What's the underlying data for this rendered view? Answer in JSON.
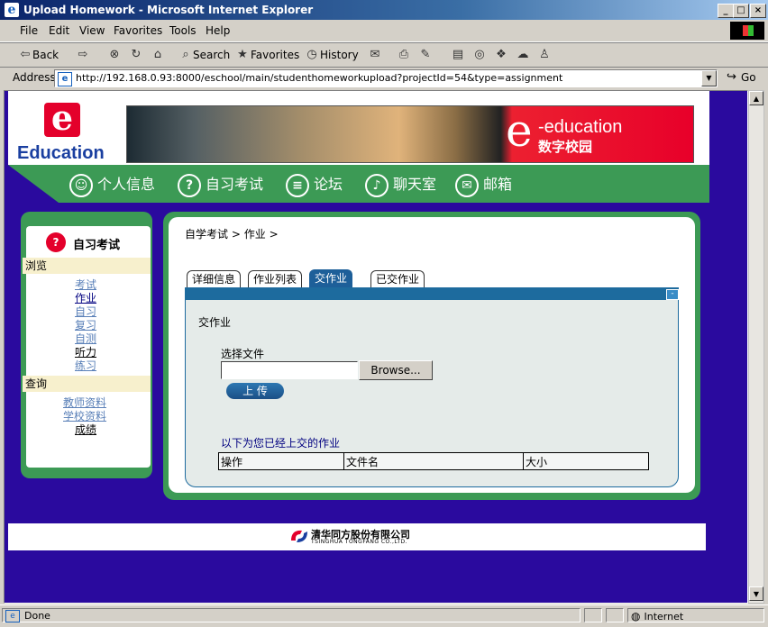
{
  "window": {
    "title": "Upload Homework - Microsoft Internet Explorer",
    "min": "_",
    "max": "□",
    "close": "×"
  },
  "menubar": [
    "File",
    "Edit",
    "View",
    "Favorites",
    "Tools",
    "Help"
  ],
  "toolbar": {
    "back": "Back",
    "search": "Search",
    "favorites": "Favorites",
    "history": "History"
  },
  "address": {
    "label": "Address",
    "url": "http://192.168.0.93:8000/eschool/main/studenthomeworkupload?projectId=54&type=assignment",
    "go": "Go"
  },
  "header": {
    "logo_letter": "e",
    "logo_text": "Education",
    "banner_e": "e",
    "banner_edu": "-education",
    "banner_cn": "数字校园"
  },
  "nav": [
    {
      "label": "个人信息",
      "icon": "person-icon"
    },
    {
      "label": "自习考试",
      "icon": "question-icon"
    },
    {
      "label": "论坛",
      "icon": "forum-icon"
    },
    {
      "label": "聊天室",
      "icon": "microphone-icon"
    },
    {
      "label": "邮箱",
      "icon": "mail-icon"
    }
  ],
  "sidebar": {
    "title": "自习考试",
    "browse_section": "浏览",
    "browse_items": [
      "考试",
      "作业",
      "自习",
      "复习",
      "自测",
      "听力",
      "练习"
    ],
    "query_section": "查询",
    "query_items": [
      "教师资料",
      "学校资料",
      "成绩"
    ]
  },
  "breadcrumb": {
    "root": "自学考试",
    "sep1": ">",
    "current": "作业",
    "sep2": ">"
  },
  "tabs": [
    "详细信息",
    "作业列表",
    "交作业",
    "已交作业"
  ],
  "active_tab": "交作业",
  "form": {
    "section_title": "交作业",
    "file_label": "选择文件",
    "file_value": "",
    "browse": "Browse...",
    "upload": "上 传",
    "list_label": "以下为您已经上交的作业",
    "columns": [
      "操作",
      "文件名",
      "大小"
    ]
  },
  "footer": {
    "company": "清华同方股份有限公司",
    "company_en": "TSINGHUA TONGFANG CO.,LTD."
  },
  "status": {
    "text": "Done",
    "zone": "Internet"
  },
  "colors": {
    "page_bg": "#2a0a9e",
    "green": "#3c9a55",
    "tab_active": "#1d5f99"
  }
}
